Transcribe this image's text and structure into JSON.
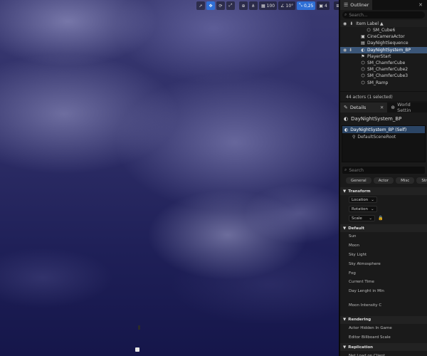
{
  "viewport": {
    "toolbar": {
      "select_icon": "cursor-icon",
      "move_icon": "move-icon",
      "rotate_icon": "rotate-icon",
      "scale_icon": "scale-icon",
      "world_icon": "globe-icon",
      "surface_snap_icon": "surface-snap-icon",
      "grid_snap_value": "100",
      "angle_snap_value": "10°",
      "scale_snap_value": "0,25",
      "camera_speed_value": "4"
    }
  },
  "outliner": {
    "tab_label": "Outliner",
    "search_placeholder": "Search...",
    "column_label": "Item Label ▲",
    "items": [
      {
        "label": "SM_Cube6",
        "icon": "static-mesh-icon",
        "indent": 3,
        "selected": false,
        "eye": false
      },
      {
        "label": "CineCameraActor",
        "icon": "camera-icon",
        "indent": 2,
        "selected": false,
        "eye": false
      },
      {
        "label": "DayNightSequence",
        "icon": "sequence-icon",
        "indent": 2,
        "selected": false,
        "eye": false
      },
      {
        "label": "DayNightSystem_BP",
        "icon": "blueprint-icon",
        "indent": 2,
        "selected": true,
        "eye": true
      },
      {
        "label": "PlayerStart",
        "icon": "player-start-icon",
        "indent": 2,
        "selected": false,
        "eye": false
      },
      {
        "label": "SM_ChamferCube",
        "icon": "static-mesh-icon",
        "indent": 2,
        "selected": false,
        "eye": false
      },
      {
        "label": "SM_ChamferCube2",
        "icon": "static-mesh-icon",
        "indent": 2,
        "selected": false,
        "eye": false
      },
      {
        "label": "SM_ChamferCube3",
        "icon": "static-mesh-icon",
        "indent": 2,
        "selected": false,
        "eye": false
      },
      {
        "label": "SM_Ramp",
        "icon": "static-mesh-icon",
        "indent": 2,
        "selected": false,
        "eye": false
      }
    ],
    "actor_count": "44 actors (1 selected)"
  },
  "details": {
    "tab_label": "Details",
    "world_settings_tab_label": "World Settin",
    "object_name": "DayNightSystem_BP",
    "components": {
      "self_label": "DayNightSystem_BP (Self)",
      "child_label": "DefaultSceneRoot"
    },
    "search_placeholder": "Search",
    "filters": [
      "General",
      "Actor",
      "Misc",
      "Stream"
    ],
    "sections": {
      "transform": "Transform",
      "default": "Default",
      "rendering": "Rendering",
      "replication": "Replication"
    },
    "transform_rows": [
      "Location",
      "Rotation",
      "Scale"
    ],
    "default_props": [
      "Sun",
      "Moon",
      "Sky Light",
      "Sky Atmosphere",
      "Fog",
      "Current Time",
      "Day Lenght in Min",
      "Moon Intensity C"
    ],
    "rendering_props": [
      "Actor Hidden In Game",
      "Editor Billboard Scale"
    ],
    "replication_props": [
      "Net Load on Client"
    ]
  }
}
